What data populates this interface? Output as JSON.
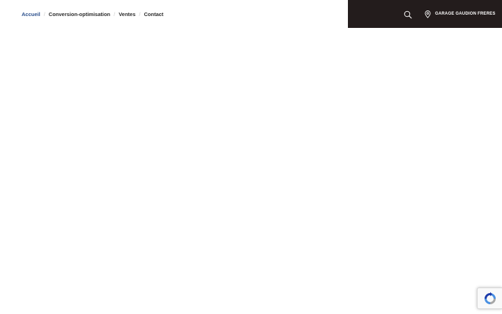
{
  "breadcrumb": {
    "items": [
      {
        "label": "Accueil",
        "active": true
      },
      {
        "label": "Conversion-optimisation",
        "active": false
      },
      {
        "label": "Ventes",
        "active": false
      },
      {
        "label": "Contact",
        "active": false
      }
    ],
    "separator": "/"
  },
  "header": {
    "background_color": "#231c1c",
    "search_icon": "search-icon",
    "location_icon": "map-pin-icon",
    "location_label": "GARAGE GAUDION FRERES"
  },
  "recaptcha": {
    "icon": "recaptcha-icon"
  },
  "colors": {
    "active_link": "#2b4f8c",
    "text": "#2b2b2b"
  }
}
